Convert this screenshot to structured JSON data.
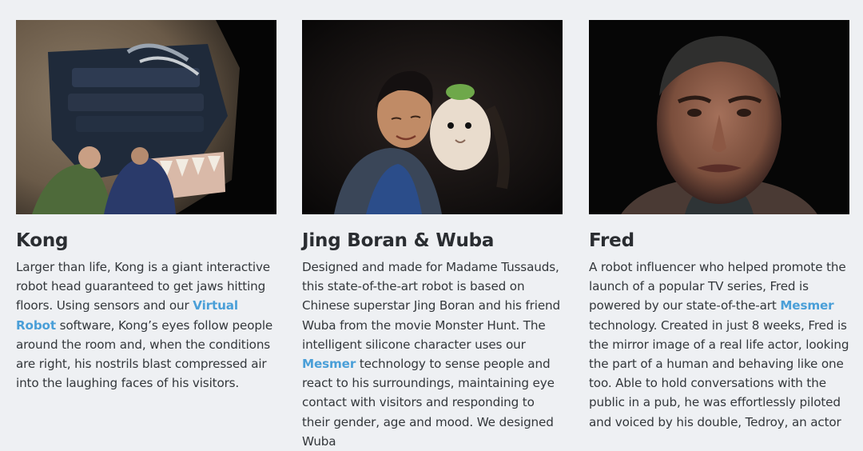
{
  "cards": [
    {
      "image_alt": "Kong animatronic head",
      "title": "Kong",
      "desc_before": "Larger than life, Kong is a giant interactive robot head guaranteed to get jaws hitting floors. Using sensors and our ",
      "link_text": "Virtual Robot",
      "desc_after": " software, Kong’s eyes follow people around the room and, when the conditions are right, his nostrils blast compressed air into the laughing faces of his visitors."
    },
    {
      "image_alt": "Jing Boran and Wuba robot",
      "title": "Jing Boran & Wuba",
      "desc_before": "Designed and made for Madame Tussauds, this state-of-the-art robot is based on Chinese superstar Jing Boran and his friend Wuba from the movie Monster Hunt. The intelligent silicone character uses our ",
      "link_text": "Mesmer",
      "desc_after": " technology to sense people and react to his surroundings, maintaining eye contact with visitors and responding to their gender, age and mood. We designed Wuba"
    },
    {
      "image_alt": "Fred robot head",
      "title": "Fred",
      "desc_before": "A robot influencer who helped promote the launch of a popular TV series, Fred is powered by our state-of-the-art ",
      "link_text": "Mesmer",
      "desc_after": " technology. Created in just 8 weeks, Fred is the mirror image of a real life actor, looking the part of a human and behaving like one too. Able to hold conversations with the public in a pub, he was effortlessly piloted and voiced by his double, Tedroy, an actor"
    }
  ],
  "colors": {
    "background": "#eef0f3",
    "link": "#4a9fd8",
    "text": "#33373b"
  }
}
